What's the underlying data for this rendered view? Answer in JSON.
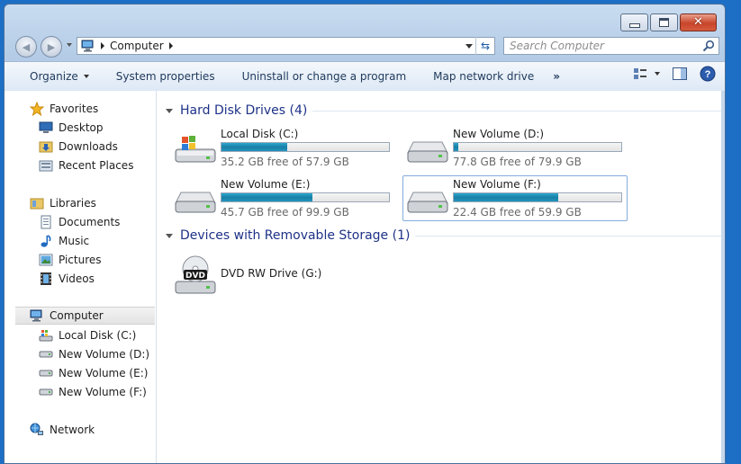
{
  "navbar": {
    "back_icon": "back-arrow-icon",
    "forward_icon": "forward-arrow-icon",
    "address": {
      "location": "Computer"
    },
    "search_placeholder": "Search Computer"
  },
  "toolbar": {
    "organize": "Organize",
    "system_properties": "System properties",
    "uninstall": "Uninstall or change a program",
    "map_drive": "Map network drive",
    "more": "»"
  },
  "nav": {
    "favorites": "Favorites",
    "desktop": "Desktop",
    "downloads": "Downloads",
    "recent": "Recent Places",
    "libraries": "Libraries",
    "documents": "Documents",
    "music": "Music",
    "pictures": "Pictures",
    "videos": "Videos",
    "computer": "Computer",
    "local_disk": "Local Disk (C:)",
    "vol_d": "New Volume (D:)",
    "vol_e": "New Volume (E:)",
    "vol_f": "New Volume (F:)",
    "network": "Network"
  },
  "groups": {
    "hdd_title": "Hard Disk Drives (4)",
    "removable_title": "Devices with Removable Storage (1)"
  },
  "drives": [
    {
      "name": "Local Disk (C:)",
      "free": "35.2 GB free of 57.9 GB",
      "used_fraction": 0.392
    },
    {
      "name": "New Volume (D:)",
      "free": "77.8 GB free of 79.9 GB",
      "used_fraction": 0.026
    },
    {
      "name": "New Volume (E:)",
      "free": "45.7 GB free of 99.9 GB",
      "used_fraction": 0.543
    },
    {
      "name": "New Volume (F:)",
      "free": "22.4 GB free of 59.9 GB",
      "used_fraction": 0.626
    }
  ],
  "dvd": {
    "name": "DVD RW Drive (G:)",
    "badge": "DVD"
  },
  "colors": {
    "accent": "#1e3287",
    "bar": "#1a7fa6",
    "selection": "#84acdd"
  }
}
